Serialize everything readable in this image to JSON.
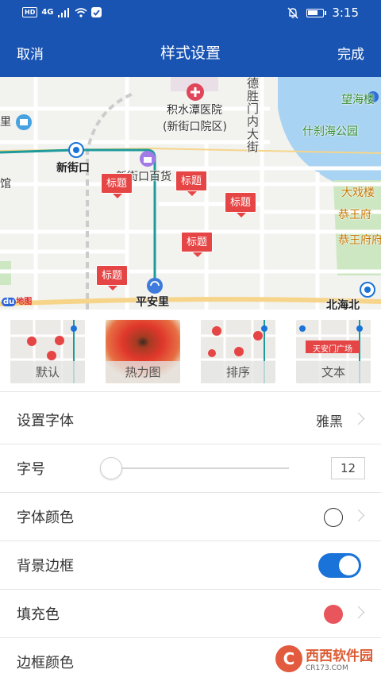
{
  "status_bar": {
    "network": "HD",
    "signal": "4G",
    "time": "3:15",
    "battery_level": 0.75
  },
  "app_bar": {
    "cancel_label": "取消",
    "title": "样式设置",
    "done_label": "完成"
  },
  "map": {
    "labels": {
      "hospital": "积水潭医院",
      "hospital_branch": "(新街口院区)",
      "road_vertical": "德胜门内大街",
      "wanghai": "望海楼",
      "shichahai": "什刹海公园",
      "xinjiekou": "新街口",
      "xinjiekou_baihuo": "新街口百货",
      "li": "里",
      "guan": "馆",
      "daxilou": "大戏楼",
      "gongwangfu": "恭王府",
      "gongwangfuzhi": "恭王府府",
      "pinganli": "平安里",
      "beihai": "北海北",
      "baidu": "地图"
    },
    "markers": [
      "标题",
      "标题",
      "标题",
      "标题",
      "标题"
    ],
    "colors": {
      "subway": "#1d9a9c",
      "rail": "#cccccc",
      "major_road": "#f6d58a",
      "water": "#a9d3f2",
      "park": "#cde7c2"
    }
  },
  "styles": [
    {
      "label": "默认"
    },
    {
      "label": "热力图"
    },
    {
      "label": "排序"
    },
    {
      "label": "文本",
      "sample": "天安门广场"
    }
  ],
  "settings": {
    "font": {
      "label": "设置字体",
      "value": "雅黑"
    },
    "font_size": {
      "label": "字号",
      "value": "12",
      "slider_level": 0.0
    },
    "font_color": {
      "label": "字体颜色",
      "color": "#ffffff"
    },
    "background_border": {
      "label": "背景边框",
      "enabled": true
    },
    "fill_color": {
      "label": "填充色",
      "color": "#e9555c"
    },
    "border_color": {
      "label": "边框颜色"
    }
  },
  "watermark": {
    "name": "西西软件园",
    "url": "CR173.COM"
  },
  "colors": {
    "primary": "#1a54b2",
    "toggle_on": "#1a73d9",
    "marker": "#e54545"
  }
}
